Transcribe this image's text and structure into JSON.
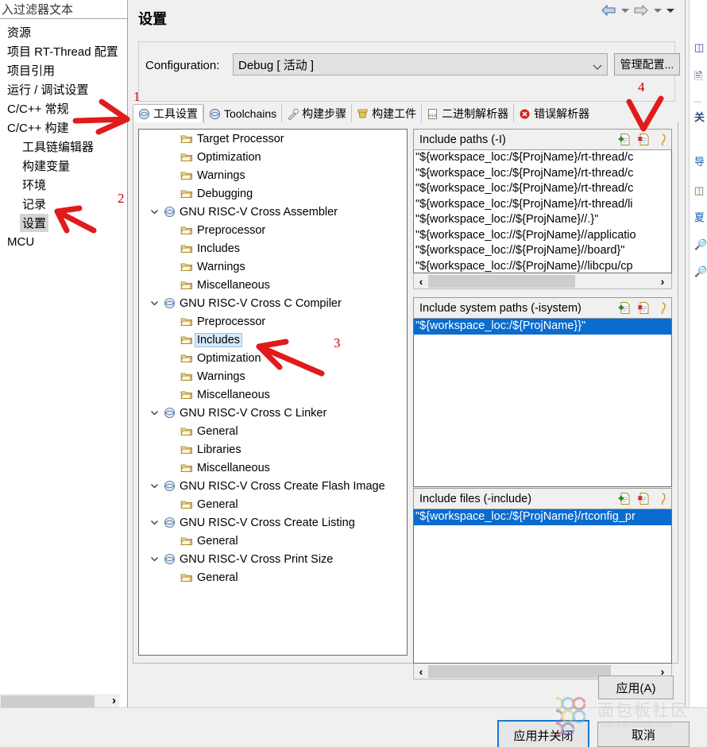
{
  "filter": {
    "value": "入过滤器文本",
    "placeholder": "输入过滤器文本"
  },
  "sidebar": {
    "items": [
      {
        "label": "资源",
        "depth": 0,
        "selected": false
      },
      {
        "label": "项目 RT-Thread 配置",
        "depth": 0,
        "selected": false
      },
      {
        "label": "项目引用",
        "depth": 0,
        "selected": false
      },
      {
        "label": "运行 / 调试设置",
        "depth": 0,
        "selected": false
      },
      {
        "label": "C/C++ 常规",
        "depth": 0,
        "selected": false
      },
      {
        "label": "C/C++ 构建",
        "depth": 0,
        "selected": false
      },
      {
        "label": "工具链编辑器",
        "depth": 1,
        "selected": false
      },
      {
        "label": "构建变量",
        "depth": 1,
        "selected": false
      },
      {
        "label": "环境",
        "depth": 1,
        "selected": false
      },
      {
        "label": "记录",
        "depth": 1,
        "selected": false
      },
      {
        "label": "设置",
        "depth": 1,
        "selected": true
      },
      {
        "label": "MCU",
        "depth": 0,
        "selected": false
      }
    ]
  },
  "header": {
    "title": "设置",
    "back_icon": "back-arrow-icon",
    "forward_icon": "forward-arrow-icon",
    "menu_icon": "view-menu-icon"
  },
  "configuration": {
    "label": "Configuration:",
    "value": "Debug [ 活动 ]",
    "manage_button": "管理配置..."
  },
  "tabs": [
    {
      "label": "工具设置",
      "icon": "tool-settings-icon",
      "active": true
    },
    {
      "label": "Toolchains",
      "icon": "toolchains-icon",
      "active": false
    },
    {
      "label": "构建步骤",
      "icon": "build-steps-icon",
      "active": false
    },
    {
      "label": "构建工件",
      "icon": "build-artifact-icon",
      "active": false
    },
    {
      "label": "二进制解析器",
      "icon": "binary-parser-icon",
      "active": false
    },
    {
      "label": "错误解析器",
      "icon": "error-parser-icon",
      "active": false
    }
  ],
  "option_tree": [
    {
      "label": "Target Processor",
      "depth": 1,
      "kind": "leaf",
      "expanded": null,
      "selected": false
    },
    {
      "label": "Optimization",
      "depth": 1,
      "kind": "leaf",
      "expanded": null,
      "selected": false
    },
    {
      "label": "Warnings",
      "depth": 1,
      "kind": "leaf",
      "expanded": null,
      "selected": false
    },
    {
      "label": "Debugging",
      "depth": 1,
      "kind": "leaf",
      "expanded": null,
      "selected": false
    },
    {
      "label": "GNU RISC-V Cross Assembler",
      "depth": 0,
      "kind": "group",
      "expanded": true,
      "selected": false
    },
    {
      "label": "Preprocessor",
      "depth": 1,
      "kind": "leaf",
      "expanded": null,
      "selected": false
    },
    {
      "label": "Includes",
      "depth": 1,
      "kind": "leaf",
      "expanded": null,
      "selected": false
    },
    {
      "label": "Warnings",
      "depth": 1,
      "kind": "leaf",
      "expanded": null,
      "selected": false
    },
    {
      "label": "Miscellaneous",
      "depth": 1,
      "kind": "leaf",
      "expanded": null,
      "selected": false
    },
    {
      "label": "GNU RISC-V Cross C Compiler",
      "depth": 0,
      "kind": "group",
      "expanded": true,
      "selected": false
    },
    {
      "label": "Preprocessor",
      "depth": 1,
      "kind": "leaf",
      "expanded": null,
      "selected": false
    },
    {
      "label": "Includes",
      "depth": 1,
      "kind": "leaf",
      "expanded": null,
      "selected": true
    },
    {
      "label": "Optimization",
      "depth": 1,
      "kind": "leaf",
      "expanded": null,
      "selected": false
    },
    {
      "label": "Warnings",
      "depth": 1,
      "kind": "leaf",
      "expanded": null,
      "selected": false
    },
    {
      "label": "Miscellaneous",
      "depth": 1,
      "kind": "leaf",
      "expanded": null,
      "selected": false
    },
    {
      "label": "GNU RISC-V Cross C Linker",
      "depth": 0,
      "kind": "group",
      "expanded": true,
      "selected": false
    },
    {
      "label": "General",
      "depth": 1,
      "kind": "leaf",
      "expanded": null,
      "selected": false
    },
    {
      "label": "Libraries",
      "depth": 1,
      "kind": "leaf",
      "expanded": null,
      "selected": false
    },
    {
      "label": "Miscellaneous",
      "depth": 1,
      "kind": "leaf",
      "expanded": null,
      "selected": false
    },
    {
      "label": "GNU RISC-V Cross Create Flash Image",
      "depth": 0,
      "kind": "group",
      "expanded": true,
      "selected": false
    },
    {
      "label": "General",
      "depth": 1,
      "kind": "leaf",
      "expanded": null,
      "selected": false
    },
    {
      "label": "GNU RISC-V Cross Create Listing",
      "depth": 0,
      "kind": "group",
      "expanded": true,
      "selected": false
    },
    {
      "label": "General",
      "depth": 1,
      "kind": "leaf",
      "expanded": null,
      "selected": false
    },
    {
      "label": "GNU RISC-V Cross Print Size",
      "depth": 0,
      "kind": "group",
      "expanded": true,
      "selected": false
    },
    {
      "label": "General",
      "depth": 1,
      "kind": "leaf",
      "expanded": null,
      "selected": false
    }
  ],
  "lists": [
    {
      "title": "Include paths (-I)",
      "icons": [
        "add-icon",
        "delete-icon",
        "edit-icon"
      ],
      "rows": [
        {
          "text": "\"${workspace_loc:/${ProjName}/rt-thread/c",
          "selected": false
        },
        {
          "text": "\"${workspace_loc:/${ProjName}/rt-thread/c",
          "selected": false
        },
        {
          "text": "\"${workspace_loc:/${ProjName}/rt-thread/c",
          "selected": false
        },
        {
          "text": "\"${workspace_loc:/${ProjName}/rt-thread/li",
          "selected": false
        },
        {
          "text": "\"${workspace_loc://${ProjName}//.}\"",
          "selected": false
        },
        {
          "text": "\"${workspace_loc://${ProjName}//applicatio",
          "selected": false
        },
        {
          "text": "\"${workspace_loc://${ProjName}//board}\"",
          "selected": false
        },
        {
          "text": "\"${workspace_loc://${ProjName}//libcpu/cp",
          "selected": false
        }
      ]
    },
    {
      "title": "Include system paths (-isystem)",
      "icons": [
        "add-icon",
        "delete-icon",
        "edit-icon"
      ],
      "rows": [
        {
          "text": "\"${workspace_loc:/${ProjName}}\"",
          "selected": true
        }
      ]
    },
    {
      "title": "Include files (-include)",
      "icons": [
        "add-icon",
        "delete-icon",
        "edit-icon"
      ],
      "rows": [
        {
          "text": "\"${workspace_loc:/${ProjName}/rtconfig_pr",
          "selected": true
        }
      ]
    }
  ],
  "buttons": {
    "apply": "应用(A)",
    "apply_and_close": "应用并关闭",
    "cancel": "取消"
  },
  "annotations": [
    {
      "number": "1"
    },
    {
      "number": "2"
    },
    {
      "number": "3"
    },
    {
      "number": "4"
    }
  ],
  "watermark": {
    "text": "面包板社区",
    "sub": "mbb.eet-china.com"
  },
  "colors": {
    "selection_blue": "#0a6cce",
    "tree_selection": "#d6eaf8",
    "annotation_red": "#d00000",
    "primary_border": "#1677d2"
  }
}
